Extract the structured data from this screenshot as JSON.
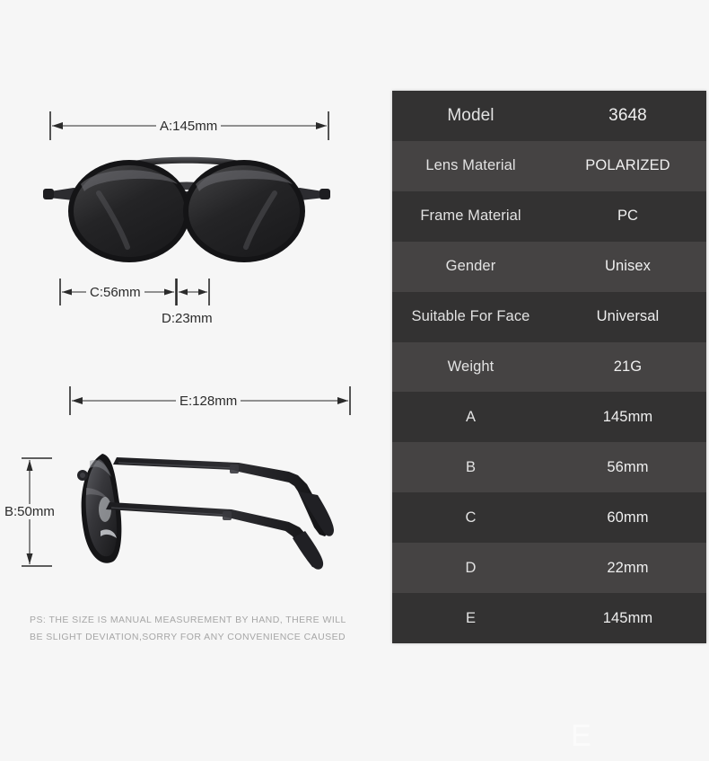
{
  "background_color": "#f6f6f6",
  "spec_table": {
    "row_color_odd": "#333232",
    "row_color_even": "#454343",
    "rows": [
      {
        "label": "Model",
        "value": "3648"
      },
      {
        "label": "Lens Material",
        "value": "POLARIZED"
      },
      {
        "label": "Frame Material",
        "value": "PC"
      },
      {
        "label": "Gender",
        "value": "Unisex"
      },
      {
        "label": "Suitable For Face",
        "value": "Universal"
      },
      {
        "label": "Weight",
        "value": "21G"
      },
      {
        "label": "A",
        "value": "145mm"
      },
      {
        "label": "B",
        "value": "56mm"
      },
      {
        "label": "C",
        "value": "60mm"
      },
      {
        "label": "D",
        "value": "22mm"
      },
      {
        "label": "E",
        "value": "145mm"
      }
    ]
  },
  "front_view": {
    "dimension_a": "A:145mm",
    "dimension_c": "C:56mm",
    "dimension_d": "D:23mm"
  },
  "side_view": {
    "dimension_e": "E:128mm",
    "dimension_b": "B:50mm"
  },
  "disclaimer": {
    "line1": "PS: THE SIZE IS MANUAL MEASUREMENT BY HAND, THERE WILL",
    "line2": "BE SLIGHT DEVIATION,SORRY FOR ANY CONVENIENCE CAUSED"
  },
  "watermark": {
    "text": "E"
  }
}
